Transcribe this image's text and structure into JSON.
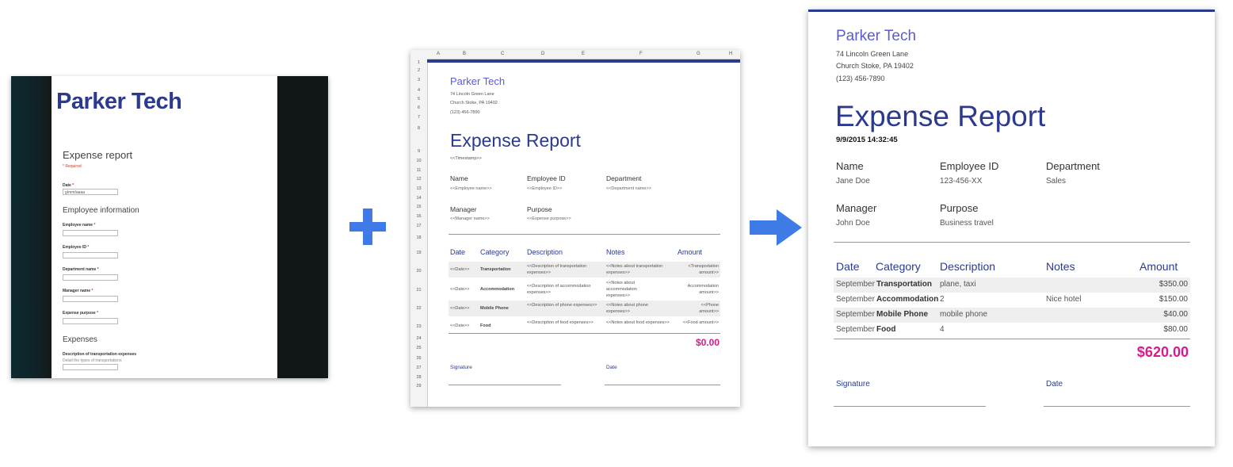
{
  "form": {
    "brand": "Parker Tech",
    "title": "Expense report",
    "required_note": "* Required",
    "date_label": "Date",
    "date_placeholder": "g/mm/aaaa",
    "section_employee": "Employee information",
    "fields": [
      {
        "label": "Employee name"
      },
      {
        "label": "Employee ID"
      },
      {
        "label": "Department name"
      },
      {
        "label": "Manager name"
      },
      {
        "label": "Expense purpose"
      }
    ],
    "section_expenses": "Expenses",
    "transport_label": "Description of transportation expenses",
    "transport_help": "Detail the types of transportations",
    "required_star": "*"
  },
  "sheet": {
    "columns": [
      "A",
      "B",
      "C",
      "D",
      "E",
      "F",
      "G",
      "H"
    ],
    "rows": [
      "1",
      "2",
      "3",
      "4",
      "5",
      "6",
      "7",
      "8",
      "9",
      "10",
      "11",
      "12",
      "13",
      "14",
      "15",
      "16",
      "17",
      "18",
      "19",
      "20",
      "21",
      "22",
      "23",
      "24",
      "25",
      "26",
      "27",
      "28",
      "29"
    ],
    "brand": "Parker Tech",
    "address1": "74 Lincoln Green Lane",
    "address2": "Church Stoke, PA 19402",
    "phone": "(123) 456-7890",
    "title": "Expense Report",
    "timestamp": "<<Timestamp>>",
    "name_label": "Name",
    "name_ph": "<<Employee name>>",
    "empid_label": "Employee ID",
    "empid_ph": "<<Employee ID>>",
    "dept_label": "Department",
    "dept_ph": "<<Department name>>",
    "manager_label": "Manager",
    "manager_ph": "<<Manager name>>",
    "purpose_label": "Purpose",
    "purpose_ph": "<<Expense purpose>>",
    "headers": [
      "Date",
      "Category",
      "Description",
      "Notes",
      "Amount"
    ],
    "table": [
      {
        "date": "<<Date>>",
        "category": "Transportation",
        "description": "<<Description of transportation expenses>>",
        "notes": "<<Notes about transportation expenses>>",
        "amount": "<Transportation amount>>"
      },
      {
        "date": "<<Date>>",
        "category": "Accommodation",
        "description": "<<Description of accommodation expenses>>",
        "notes": "<<Notes about accommodation expenses>>",
        "amount": "Accommodation amount>>"
      },
      {
        "date": "<<Date>>",
        "category": "Mobile Phone",
        "description": "<<Description of phone expenses>>",
        "notes": "<<Notes about phone expenses>>",
        "amount": "<<Phone amount>>"
      },
      {
        "date": "<<Date>>",
        "category": "Food",
        "description": "<<Description of food expenses>>",
        "notes": "<<Notes about food expenses>>",
        "amount": "<<Food amount>>"
      }
    ],
    "total": "$0.00",
    "signature_label": "Signature",
    "date_label": "Date"
  },
  "report": {
    "brand": "Parker Tech",
    "address1": "74 Lincoln Green Lane",
    "address2": "Church Stoke, PA 19402",
    "phone": "(123) 456-7890",
    "title": "Expense Report",
    "timestamp": "9/9/2015 14:32:45",
    "name_label": "Name",
    "name_value": "Jane Doe",
    "empid_label": "Employee ID",
    "empid_value": "123-456-XX",
    "dept_label": "Department",
    "dept_value": "Sales",
    "manager_label": "Manager",
    "manager_value": "John Doe",
    "purpose_label": "Purpose",
    "purpose_value": "Business travel",
    "headers": [
      "Date",
      "Category",
      "Description",
      "Notes",
      "Amount"
    ],
    "table": [
      {
        "date": "September",
        "category": "Transportation",
        "description": "plane, taxi",
        "notes": "",
        "amount": "$350.00"
      },
      {
        "date": "September",
        "category": "Accommodation",
        "description": "2",
        "notes": "Nice hotel",
        "amount": "$150.00"
      },
      {
        "date": "September",
        "category": "Mobile Phone",
        "description": "mobile phone",
        "notes": "",
        "amount": "$40.00"
      },
      {
        "date": "September",
        "category": "Food",
        "description": "4",
        "notes": "",
        "amount": "$80.00"
      }
    ],
    "total": "$620.00",
    "signature_label": "Signature",
    "date_label": "Date"
  },
  "colors": {
    "brand_blue": "#2b3a8f",
    "brand_light": "#5b5bd6",
    "accent_plus": "#3f7be6",
    "total_pink": "#d81b8a"
  }
}
